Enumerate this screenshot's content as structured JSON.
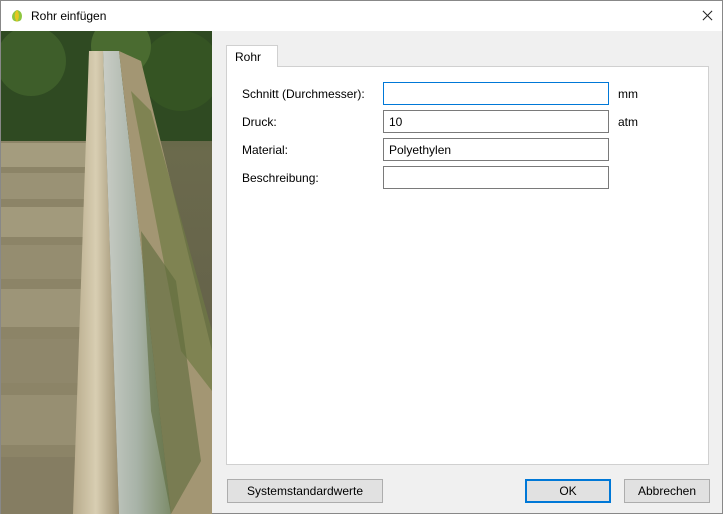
{
  "window": {
    "title": "Rohr einfügen",
    "app_icon": "leaf-icon",
    "close_icon": "close-icon"
  },
  "tabs": [
    {
      "label": "Rohr",
      "active": true
    }
  ],
  "form": {
    "diameter": {
      "label": "Schnitt (Durchmesser):",
      "value": "",
      "unit": "mm"
    },
    "pressure": {
      "label": "Druck:",
      "value": "10",
      "unit": "atm"
    },
    "material": {
      "label": "Material:",
      "value": "Polyethylen"
    },
    "description": {
      "label": "Beschreibung:",
      "value": ""
    }
  },
  "buttons": {
    "defaults": "Systemstandardwerte",
    "ok": "OK",
    "cancel": "Abbrechen"
  },
  "colors": {
    "accent": "#0078d7",
    "icon_green": "#8dc63f"
  }
}
